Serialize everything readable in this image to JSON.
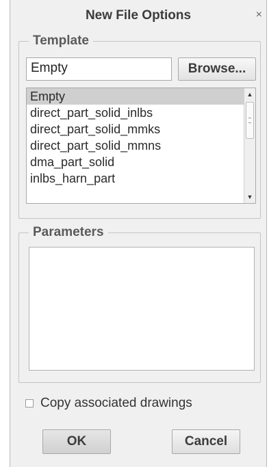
{
  "dialog": {
    "title": "New File Options",
    "close_glyph": "×"
  },
  "template": {
    "legend": "Template",
    "input_value": "Empty",
    "browse_label": "Browse...",
    "items": [
      {
        "label": "Empty",
        "selected": true
      },
      {
        "label": "direct_part_solid_inlbs",
        "selected": false
      },
      {
        "label": "direct_part_solid_mmks",
        "selected": false
      },
      {
        "label": "direct_part_solid_mmns",
        "selected": false
      },
      {
        "label": "dma_part_solid",
        "selected": false
      },
      {
        "label": "inlbs_harn_part",
        "selected": false
      }
    ]
  },
  "parameters": {
    "legend": "Parameters"
  },
  "copy_drawings": {
    "label": "Copy associated drawings",
    "checked": false
  },
  "buttons": {
    "ok_label": "OK",
    "cancel_label": "Cancel"
  },
  "icons": {
    "close": "close-icon",
    "scroll_up": "scroll-up-arrow-icon",
    "scroll_down": "scroll-down-arrow-icon"
  }
}
